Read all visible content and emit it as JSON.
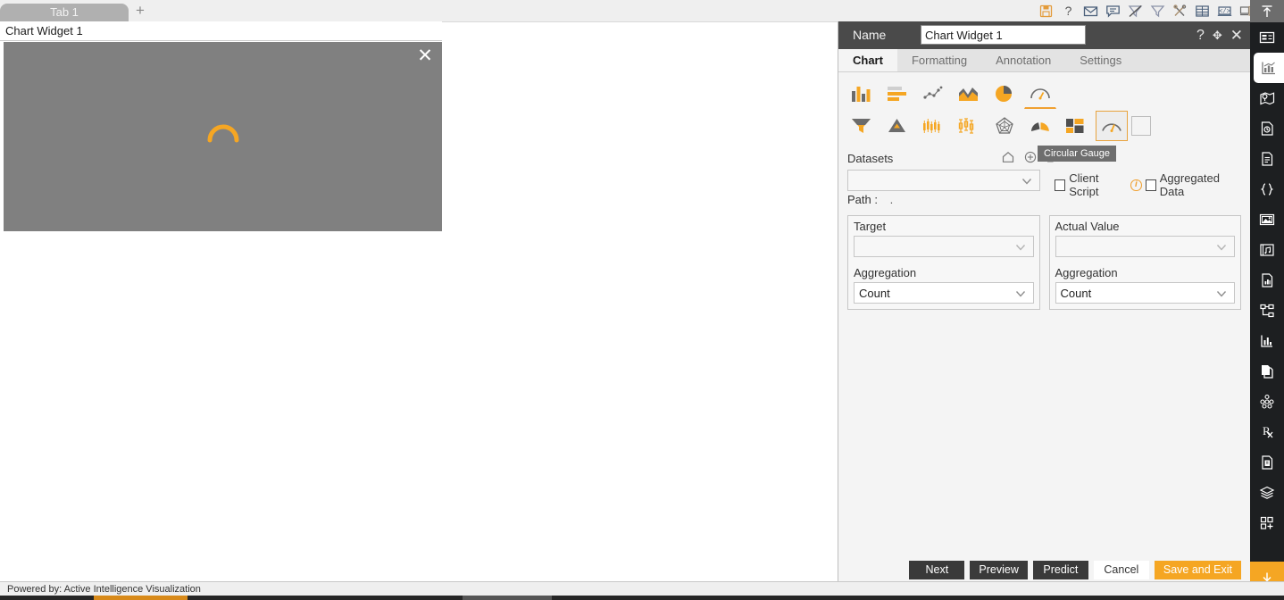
{
  "topbar": {
    "tabs": [
      {
        "label": "Tab 1"
      }
    ],
    "add_tab_label": "+",
    "tool_icons": [
      {
        "name": "save-icon",
        "title": "Save"
      },
      {
        "name": "help-question-icon",
        "title": "Help"
      },
      {
        "name": "mail-envelope-icon",
        "title": "Mail"
      },
      {
        "name": "comment-bubble-icon",
        "title": "Comment"
      },
      {
        "name": "clear-filter-icon",
        "title": "Clear Filter"
      },
      {
        "name": "filter-funnel-icon",
        "title": "Filter"
      },
      {
        "name": "tools-icon",
        "title": "Tools"
      },
      {
        "name": "table-grid-icon",
        "title": "Table"
      },
      {
        "name": "code-window-icon",
        "title": "Code"
      },
      {
        "name": "copy-screen-icon",
        "title": "Copy"
      },
      {
        "name": "play-run-icon",
        "title": "Run"
      }
    ]
  },
  "canvas": {
    "widget_title": "Chart Widget 1",
    "close_label": "✕",
    "spinner_name": "loading-spinner"
  },
  "footer": {
    "powered_by": "Powered by: Active Intelligence Visualization"
  },
  "panel": {
    "name_label": "Name",
    "name_value": "Chart Widget 1",
    "name_placeholder": "Chart Widget 1",
    "header_buttons": [
      {
        "name": "panel-help-button",
        "glyph": "?"
      },
      {
        "name": "panel-move-button",
        "glyph": "✥"
      },
      {
        "name": "panel-close-button",
        "glyph": "✕"
      }
    ],
    "tabs": [
      {
        "label": "Chart",
        "active": true
      },
      {
        "label": "Formatting",
        "active": false
      },
      {
        "label": "Annotation",
        "active": false
      },
      {
        "label": "Settings",
        "active": false
      }
    ],
    "chart_types_row1": [
      {
        "name": "chart-type-column",
        "label": "Column Chart",
        "selected": false
      },
      {
        "name": "chart-type-bar",
        "label": "Bar Chart",
        "selected": false
      },
      {
        "name": "chart-type-scatter",
        "label": "Scatter Chart",
        "selected": false
      },
      {
        "name": "chart-type-area",
        "label": "Area Chart",
        "selected": false
      },
      {
        "name": "chart-type-pie",
        "label": "Pie Chart",
        "selected": false
      },
      {
        "name": "chart-type-gauge-row1",
        "label": "Gauge",
        "selected": false
      }
    ],
    "chart_types_row2": [
      {
        "name": "chart-type-funnel",
        "label": "Funnel Chart",
        "selected": false
      },
      {
        "name": "chart-type-pyramid",
        "label": "Pyramid Chart",
        "selected": false
      },
      {
        "name": "chart-type-candlestick",
        "label": "Candlestick Chart",
        "selected": false
      },
      {
        "name": "chart-type-boxplot",
        "label": "Box Plot",
        "selected": false
      },
      {
        "name": "chart-type-radar",
        "label": "Radar Chart",
        "selected": false
      },
      {
        "name": "chart-type-semi-gauge",
        "label": "Semi Gauge",
        "selected": false
      },
      {
        "name": "chart-type-treemap",
        "label": "Treemap",
        "selected": false
      },
      {
        "name": "chart-type-circular-gauge",
        "label": "Circular Gauge",
        "selected": true
      },
      {
        "name": "chart-type-blank",
        "label": "Blank",
        "selected": false
      }
    ],
    "tooltip_text": "Circular Gauge",
    "datasets": {
      "label": "Datasets",
      "selected": "",
      "icons": [
        {
          "name": "dataset-home-icon",
          "title": "Home"
        },
        {
          "name": "dataset-add-icon",
          "title": "Add"
        },
        {
          "name": "dataset-edit-icon",
          "title": "Edit"
        }
      ]
    },
    "client_script": {
      "label": "Client Script",
      "checked": false
    },
    "aggregated_data": {
      "label": "Aggregated Data",
      "checked": false
    },
    "path": {
      "label": "Path :",
      "value": "."
    },
    "target": {
      "label": "Target",
      "value": "",
      "aggregation_label": "Aggregation",
      "aggregation_value": "Count"
    },
    "actual_value": {
      "label": "Actual Value",
      "value": "",
      "aggregation_label": "Aggregation",
      "aggregation_value": "Count"
    },
    "buttons": [
      {
        "name": "next-button",
        "label": "Next",
        "style": "dark"
      },
      {
        "name": "preview-button",
        "label": "Preview",
        "style": "dark"
      },
      {
        "name": "predict-button",
        "label": "Predict",
        "style": "dark"
      },
      {
        "name": "cancel-button",
        "label": "Cancel",
        "style": "light"
      },
      {
        "name": "save-and-exit-button",
        "label": "Save and Exit",
        "style": "accent"
      }
    ]
  },
  "rail": {
    "top_icon": {
      "name": "collapse-up-icon"
    },
    "items": [
      {
        "name": "rail-widget-icon",
        "active": false
      },
      {
        "name": "rail-chart-icon",
        "active": true
      },
      {
        "name": "rail-map-icon",
        "active": false
      },
      {
        "name": "rail-data-source-icon",
        "active": false
      },
      {
        "name": "rail-document-icon",
        "active": false
      },
      {
        "name": "rail-json-icon",
        "active": false
      },
      {
        "name": "rail-image-icon",
        "active": false
      },
      {
        "name": "rail-media-icon",
        "active": false
      },
      {
        "name": "rail-report-icon",
        "active": false
      },
      {
        "name": "rail-hierarchy-icon",
        "active": false
      },
      {
        "name": "rail-kpi-icon",
        "active": false
      },
      {
        "name": "rail-copy-icon",
        "active": false
      },
      {
        "name": "rail-cluster-icon",
        "active": false
      },
      {
        "name": "rail-prescription-icon",
        "active": false
      },
      {
        "name": "rail-script-icon",
        "active": false
      },
      {
        "name": "rail-layers-icon",
        "active": false
      },
      {
        "name": "rail-add-widget-icon",
        "active": false
      }
    ],
    "bottom_icon": {
      "name": "download-icon"
    }
  },
  "colors": {
    "accent": "#f5a623",
    "panel_bg": "#f4f4f4",
    "header_bg": "#4a4a4a",
    "canvas_bg": "#808080",
    "rail_bg": "#1d1f21"
  }
}
